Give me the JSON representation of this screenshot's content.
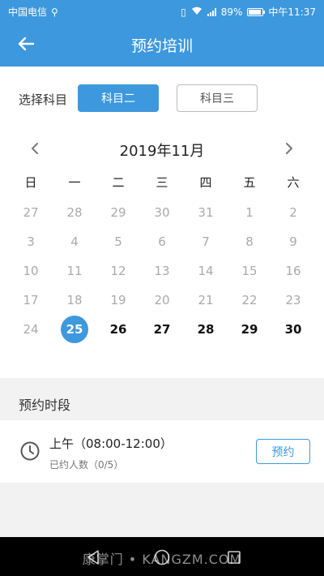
{
  "status": {
    "carrier": "中国电信",
    "battery": "89%",
    "time": "中午11:37",
    "battery_level": 0.89
  },
  "header": {
    "title": "预约培训"
  },
  "subject": {
    "label": "选择科目",
    "options": [
      {
        "label": "科目二",
        "selected": true
      },
      {
        "label": "科目三",
        "selected": false
      }
    ]
  },
  "calendar": {
    "month_label": "2019年11月",
    "weekdays": [
      "日",
      "一",
      "二",
      "三",
      "四",
      "五",
      "六"
    ],
    "days": [
      {
        "d": "27",
        "state": "disabled"
      },
      {
        "d": "28",
        "state": "disabled"
      },
      {
        "d": "29",
        "state": "disabled"
      },
      {
        "d": "30",
        "state": "disabled"
      },
      {
        "d": "31",
        "state": "disabled"
      },
      {
        "d": "1",
        "state": "disabled"
      },
      {
        "d": "2",
        "state": "disabled"
      },
      {
        "d": "3",
        "state": "disabled"
      },
      {
        "d": "4",
        "state": "disabled"
      },
      {
        "d": "5",
        "state": "disabled"
      },
      {
        "d": "6",
        "state": "disabled"
      },
      {
        "d": "7",
        "state": "disabled"
      },
      {
        "d": "8",
        "state": "disabled"
      },
      {
        "d": "9",
        "state": "disabled"
      },
      {
        "d": "10",
        "state": "disabled"
      },
      {
        "d": "11",
        "state": "disabled"
      },
      {
        "d": "12",
        "state": "disabled"
      },
      {
        "d": "13",
        "state": "disabled"
      },
      {
        "d": "14",
        "state": "disabled"
      },
      {
        "d": "15",
        "state": "disabled"
      },
      {
        "d": "16",
        "state": "disabled"
      },
      {
        "d": "17",
        "state": "disabled"
      },
      {
        "d": "18",
        "state": "disabled"
      },
      {
        "d": "19",
        "state": "disabled"
      },
      {
        "d": "20",
        "state": "disabled"
      },
      {
        "d": "21",
        "state": "disabled"
      },
      {
        "d": "22",
        "state": "disabled"
      },
      {
        "d": "23",
        "state": "disabled"
      },
      {
        "d": "24",
        "state": "disabled"
      },
      {
        "d": "25",
        "state": "selected"
      },
      {
        "d": "26",
        "state": "available"
      },
      {
        "d": "27",
        "state": "available"
      },
      {
        "d": "28",
        "state": "available"
      },
      {
        "d": "29",
        "state": "available"
      },
      {
        "d": "30",
        "state": "available"
      }
    ]
  },
  "periods": {
    "title": "预约时段",
    "slots": [
      {
        "time": "上午（08:00-12:00）",
        "count": "已约人数（0/5）",
        "button": "预约"
      }
    ]
  },
  "watermark": "康掌门 • KANGZM.COM",
  "colors": {
    "accent": "#3d98dd"
  }
}
